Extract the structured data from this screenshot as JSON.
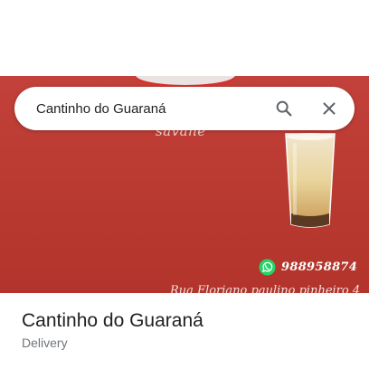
{
  "search": {
    "query": "Cantinho do Guaraná"
  },
  "banner": {
    "script_text": "savane",
    "phone": "988958874",
    "address": "Rua Floriano paulino pinheiro 4"
  },
  "place": {
    "name": "Cantinho do Guaraná",
    "category": "Delivery"
  },
  "icons": {
    "search": "search-icon",
    "close": "close-icon",
    "whatsapp": "whatsapp-icon"
  },
  "colors": {
    "banner_red": "#c2413b",
    "whatsapp_green": "#25d366",
    "text_primary": "#202124",
    "text_secondary": "#70757a"
  }
}
